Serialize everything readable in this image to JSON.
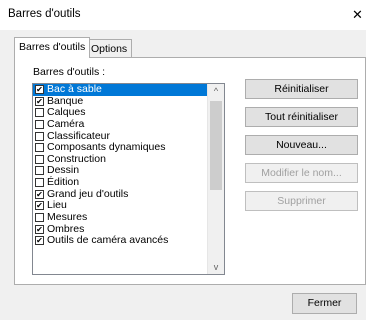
{
  "window": {
    "title": "Barres d'outils",
    "close_glyph": "✕"
  },
  "tabs": [
    {
      "label": "Barres d'outils",
      "active": true
    },
    {
      "label": "Options",
      "active": false
    }
  ],
  "panel": {
    "list_label": "Barres d'outils :",
    "items": [
      {
        "label": "Bac à sable",
        "checked": true,
        "selected": true
      },
      {
        "label": "Banque",
        "checked": true,
        "selected": false
      },
      {
        "label": "Calques",
        "checked": false,
        "selected": false
      },
      {
        "label": "Caméra",
        "checked": false,
        "selected": false
      },
      {
        "label": "Classificateur",
        "checked": false,
        "selected": false
      },
      {
        "label": "Composants dynamiques",
        "checked": false,
        "selected": false
      },
      {
        "label": "Construction",
        "checked": false,
        "selected": false
      },
      {
        "label": "Dessin",
        "checked": false,
        "selected": false
      },
      {
        "label": "Édition",
        "checked": false,
        "selected": false
      },
      {
        "label": "Grand jeu d'outils",
        "checked": true,
        "selected": false
      },
      {
        "label": "Lieu",
        "checked": true,
        "selected": false
      },
      {
        "label": "Mesures",
        "checked": false,
        "selected": false
      },
      {
        "label": "Ombres",
        "checked": true,
        "selected": false
      },
      {
        "label": "Outils de caméra avancés",
        "checked": true,
        "selected": false
      }
    ],
    "buttons": {
      "reset": "Réinitialiser",
      "reset_all": "Tout réinitialiser",
      "new": "Nouveau...",
      "rename": "Modifier le nom...",
      "delete": "Supprimer"
    }
  },
  "footer": {
    "close": "Fermer"
  },
  "scroll": {
    "up": "^",
    "down": "v"
  }
}
